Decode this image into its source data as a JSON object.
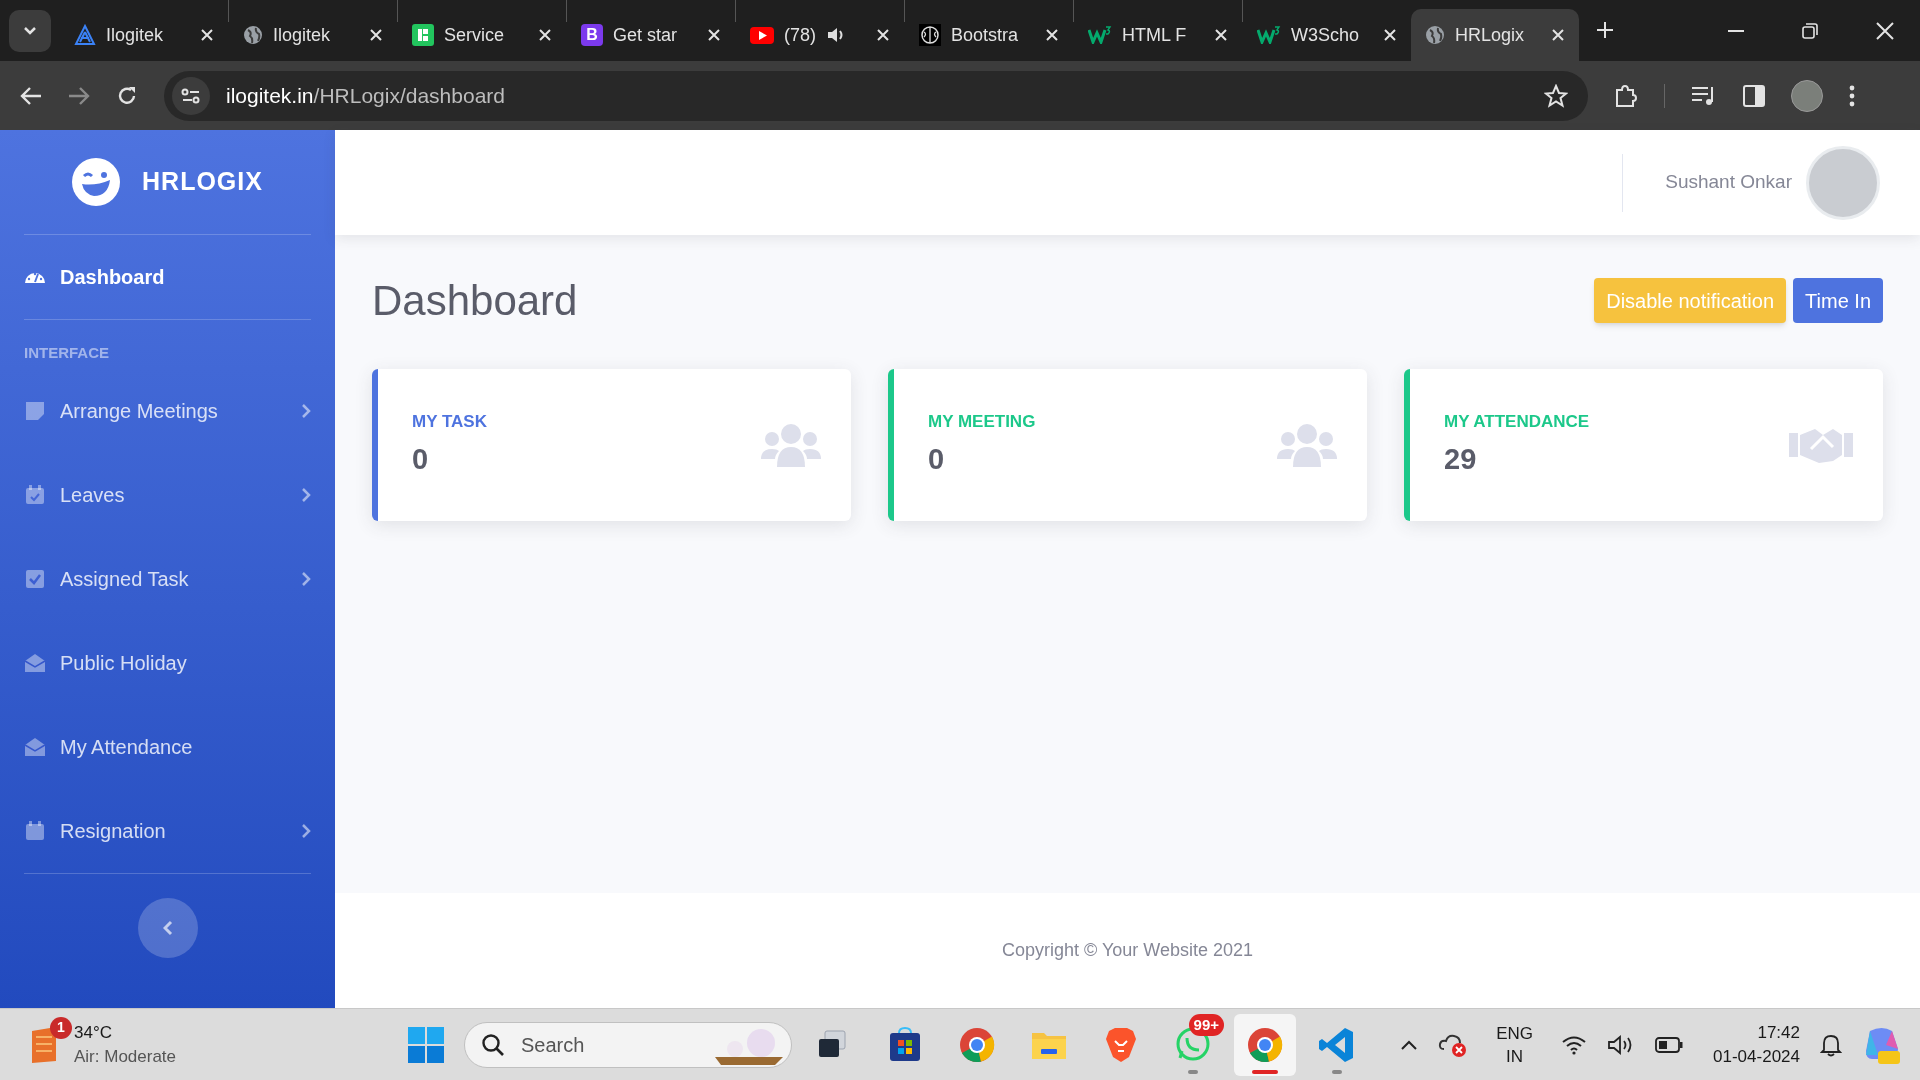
{
  "browser": {
    "tabs": [
      {
        "title": "Ilogitek",
        "kind": "triangle",
        "selected": false,
        "audio": false
      },
      {
        "title": "Ilogitek",
        "kind": "globe",
        "selected": false,
        "audio": false
      },
      {
        "title": "Service",
        "kind": "square",
        "selected": false,
        "audio": false
      },
      {
        "title": "Get star",
        "kind": "letter",
        "letter": "B",
        "selected": false,
        "audio": false
      },
      {
        "title": "(78)",
        "kind": "play",
        "selected": false,
        "audio": true
      },
      {
        "title": "Bootstra",
        "kind": "brain",
        "selected": false,
        "audio": false
      },
      {
        "title": "HTML F",
        "kind": "w3",
        "selected": false,
        "audio": false
      },
      {
        "title": "W3Scho",
        "kind": "w3",
        "selected": false,
        "audio": false
      },
      {
        "title": "HRLogix",
        "kind": "globe",
        "selected": true,
        "audio": false
      }
    ],
    "url_host": "ilogitek.in",
    "url_path": "/HRLogix/dashboard"
  },
  "sidebar": {
    "brand": "HRLOGIX",
    "groups": [
      {
        "items": [
          {
            "label": "Dashboard",
            "kind": "gauge",
            "selected": true,
            "has_submenu": false
          }
        ]
      },
      {
        "heading": "INTERFACE",
        "items": [
          {
            "label": "Arrange Meetings",
            "kind": "note",
            "selected": false,
            "has_submenu": true
          },
          {
            "label": "Leaves",
            "kind": "calendar-check",
            "selected": false,
            "has_submenu": true
          },
          {
            "label": "Assigned Task",
            "kind": "check-square",
            "selected": false,
            "has_submenu": true
          },
          {
            "label": "Public Holiday",
            "kind": "envelope-open",
            "selected": false,
            "has_submenu": false
          },
          {
            "label": "My Attendance",
            "kind": "envelope-open",
            "selected": false,
            "has_submenu": false
          },
          {
            "label": "Resignation",
            "kind": "calendar",
            "selected": false,
            "has_submenu": true
          }
        ]
      }
    ]
  },
  "header": {
    "user_name": "Sushant Onkar"
  },
  "page": {
    "title": "Dashboard",
    "buttons": [
      {
        "label": "Disable notification",
        "kind": "warning"
      },
      {
        "label": "Time In",
        "kind": "primary"
      }
    ],
    "cards": [
      {
        "label": "MY TASK",
        "value": "0",
        "color": "#4e73df",
        "kind": "users"
      },
      {
        "label": "MY MEETING",
        "value": "0",
        "color": "#1cc88a",
        "kind": "users"
      },
      {
        "label": "MY ATTENDANCE",
        "value": "29",
        "color": "#1cc88a",
        "kind": "handshake"
      }
    ]
  },
  "footer": {
    "text": "Copyright © Your Website 2021"
  },
  "taskbar": {
    "weather": {
      "temp": "34°C",
      "desc": "Air: Moderate",
      "badge": "1"
    },
    "search_placeholder": "Search",
    "apps": [
      {
        "kind": "task-view",
        "running": false,
        "selected": false
      },
      {
        "kind": "store",
        "running": false,
        "selected": false
      },
      {
        "kind": "chrome",
        "running": false,
        "selected": false
      },
      {
        "kind": "folder",
        "running": false,
        "selected": false
      },
      {
        "kind": "lion",
        "running": false,
        "selected": false
      },
      {
        "kind": "chat",
        "running": true,
        "selected": false,
        "badge": "99+"
      },
      {
        "kind": "chrome",
        "running": true,
        "selected": true
      },
      {
        "kind": "code",
        "running": true,
        "selected": false
      }
    ],
    "language": "ENG",
    "region": "IN",
    "time": "17:42",
    "date": "01-04-2024"
  }
}
